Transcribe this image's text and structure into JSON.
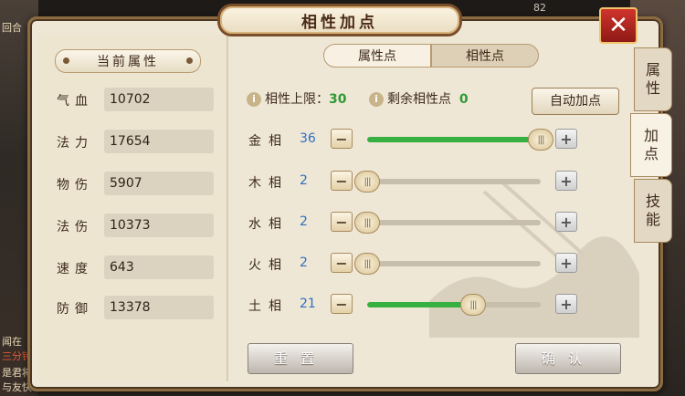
{
  "title": "相性加点",
  "close_label": "✕",
  "left_section_title": "当前属性",
  "attributes": [
    {
      "label": "气血",
      "value": "10702"
    },
    {
      "label": "法力",
      "value": "17654"
    },
    {
      "label": "物伤",
      "value": "5907"
    },
    {
      "label": "法伤",
      "value": "10373"
    },
    {
      "label": "速度",
      "value": "643"
    },
    {
      "label": "防御",
      "value": "13378"
    }
  ],
  "tabs": [
    "属性点",
    "相性点"
  ],
  "side_tabs": [
    {
      "line1": "属",
      "line2": "性"
    },
    {
      "line1": "加",
      "line2": "点"
    },
    {
      "line1": "技",
      "line2": "能"
    }
  ],
  "info": {
    "limit_label": "相性上限：",
    "limit_value": "30",
    "remain_label": "剩余相性点",
    "remain_value": "0",
    "info_icon": "i"
  },
  "auto_button": "自动加点",
  "affinities": [
    {
      "label": "金相",
      "value": "36",
      "fraction": 1.0
    },
    {
      "label": "木相",
      "value": "2",
      "fraction": 0.0
    },
    {
      "label": "水相",
      "value": "2",
      "fraction": 0.0
    },
    {
      "label": "火相",
      "value": "2",
      "fraction": 0.0
    },
    {
      "label": "土相",
      "value": "21",
      "fraction": 0.61
    }
  ],
  "knob_glyph": "|||",
  "minus_glyph": "−",
  "plus_glyph": "+",
  "reset_button": "重置",
  "confirm_button": "确认",
  "background_texts": {
    "round": "回合",
    "top_number": "82",
    "chat1": "闻在",
    "chat2": "三分钟",
    "chat3": "是君将",
    "chat4": "与友快"
  }
}
